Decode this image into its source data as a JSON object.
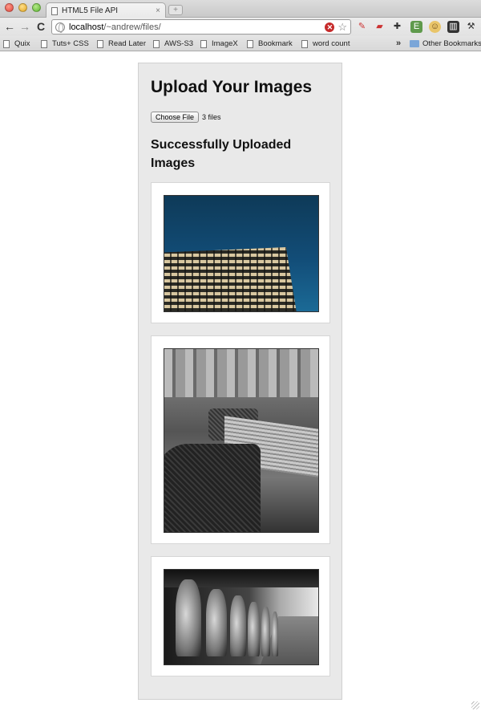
{
  "browser": {
    "tab_title": "HTML5 File API",
    "tab_close": "×",
    "new_tab": "+",
    "url_host": "localhost",
    "url_path": "/~andrew/files/",
    "nav": {
      "back": "←",
      "forward": "→",
      "reload": "C"
    },
    "bookmarks": [
      "Quix",
      "Tuts+ CSS",
      "Read Later",
      "AWS-S3",
      "ImageX",
      "Bookmark",
      "word count"
    ],
    "bookmarks_overflow": "»",
    "other_bookmarks": "Other Bookmarks"
  },
  "page": {
    "title": "Upload Your Images",
    "choose_file_label": "Choose File",
    "file_status": "3 files",
    "section_heading": "Successfully Uploaded Images"
  }
}
